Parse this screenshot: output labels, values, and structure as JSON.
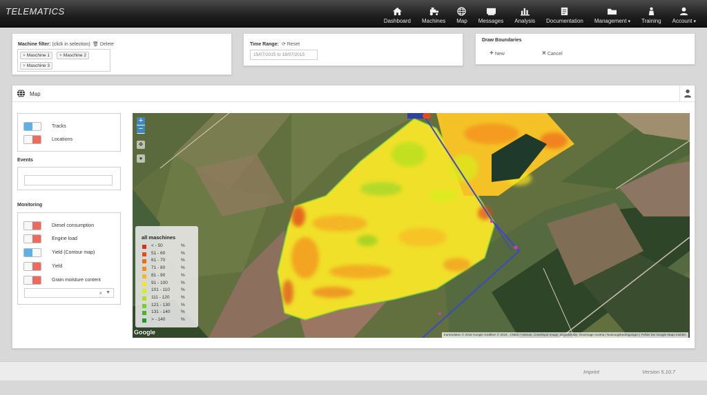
{
  "brand": "TELEMATICS",
  "nav": [
    {
      "label": "Dashboard",
      "icon": "home-icon"
    },
    {
      "label": "Machines",
      "icon": "tractor-icon"
    },
    {
      "label": "Map",
      "icon": "globe-icon"
    },
    {
      "label": "Messages",
      "icon": "messages-icon"
    },
    {
      "label": "Analysis",
      "icon": "bar-chart-icon"
    },
    {
      "label": "Documentation",
      "icon": "document-icon"
    },
    {
      "label": "Management",
      "icon": "folder-icon"
    },
    {
      "label": "Training",
      "icon": "training-icon"
    },
    {
      "label": "Account",
      "icon": "user-icon"
    }
  ],
  "machine_filter": {
    "label": "Machine filter:",
    "note": "(click in selection)",
    "delete_label": "Delete",
    "tags": [
      "Maschine 1",
      "Maschine 2",
      "Maschine 3"
    ]
  },
  "time_range": {
    "label": "Time Range:",
    "reset_label": "Reset",
    "value": "15/07/2015 to 18/07/2015"
  },
  "draw_boundaries": {
    "label": "Draw Boundaries",
    "new_label": "New",
    "cancel_label": "Cancel"
  },
  "map": {
    "title": "Map",
    "layers": {
      "tracks": "Tracks",
      "locations": "Locations"
    },
    "events_label": "Events",
    "monitoring_label": "Monitoring",
    "monitoring": {
      "diesel": "Diesel consumption",
      "engine": "Engine load",
      "yield_contour": "Yield (Contour map)",
      "yield": "Yield",
      "grain": "Grain moisture content"
    },
    "legend": {
      "title": "all maschines",
      "unit": "%",
      "rows": [
        {
          "range": "< - 50",
          "color": "#d7301f"
        },
        {
          "range": "51 - 60",
          "color": "#e34a1c"
        },
        {
          "range": "61 - 70",
          "color": "#ee6a1a"
        },
        {
          "range": "71 - 80",
          "color": "#f58a1e"
        },
        {
          "range": "81 - 90",
          "color": "#f8b823"
        },
        {
          "range": "91 - 100",
          "color": "#f7e51f"
        },
        {
          "range": "101 - 110",
          "color": "#d7ec1c"
        },
        {
          "range": "111 - 120",
          "color": "#aee01e"
        },
        {
          "range": "121 - 130",
          "color": "#7bcc22"
        },
        {
          "range": "131 - 140",
          "color": "#45b62a"
        },
        {
          "range": "> - 140",
          "color": "#1f9a2e"
        }
      ]
    },
    "google_logo": "Google",
    "attribution": "Kartendaten © 2016 Google Grafiken © 2016 , CNES / Astrium, Cnes/Spot Image, DigitalGlobe, Geoimage Austria | Nutzungsbedingungen | Fehler bei Google Maps melden"
  },
  "footer": {
    "imprint": "Imprint",
    "version": "Version 5.10.7"
  }
}
